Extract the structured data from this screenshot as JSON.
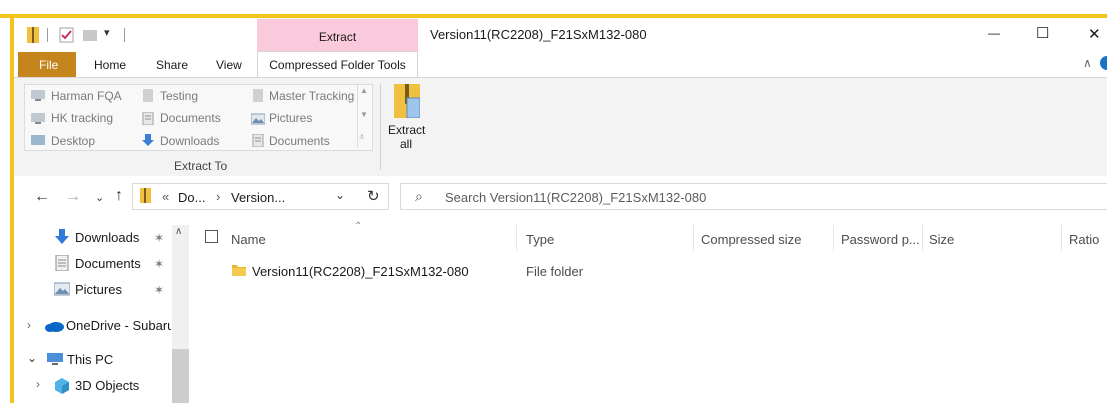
{
  "window": {
    "title": "Version11(RC2208)_F21SxM132-080",
    "context_tab_group": "Extract",
    "controls": {
      "minimize": "—",
      "maximize": "☐",
      "close": "✕"
    }
  },
  "ribbon": {
    "tabs": {
      "file": "File",
      "home": "Home",
      "share": "Share",
      "view": "View",
      "compressed": "Compressed Folder Tools"
    },
    "extract_to": {
      "items": [
        "Harman FQA",
        "Testing",
        "Master Tracking",
        "HK tracking",
        "Documents",
        "Pictures",
        "Desktop",
        "Downloads",
        "Documents"
      ],
      "group_label": "Extract To"
    },
    "extract_all": {
      "line1": "Extract",
      "line2": "all"
    },
    "collapse_glyph": "∧"
  },
  "address": {
    "overflow": "«",
    "crumbs": [
      "Do...",
      "Version..."
    ],
    "separator": "›",
    "search_placeholder": "Search Version11(RC2208)_F21SxM132-080"
  },
  "nav": {
    "items": [
      "Downloads",
      "Documents",
      "Pictures",
      "OneDrive - Subaru",
      "This PC",
      "3D Objects"
    ]
  },
  "columns": [
    "Name",
    "Type",
    "Compressed size",
    "Password p...",
    "Size",
    "Ratio"
  ],
  "rows": [
    {
      "name": "Version11(RC2208)_F21SxM132-080",
      "type": "File folder"
    }
  ],
  "colors": {
    "accent": "#f3c41b",
    "file_tab": "#c6851c",
    "context_tab": "#fbc9dc",
    "onedrive": "#0a67c8"
  }
}
